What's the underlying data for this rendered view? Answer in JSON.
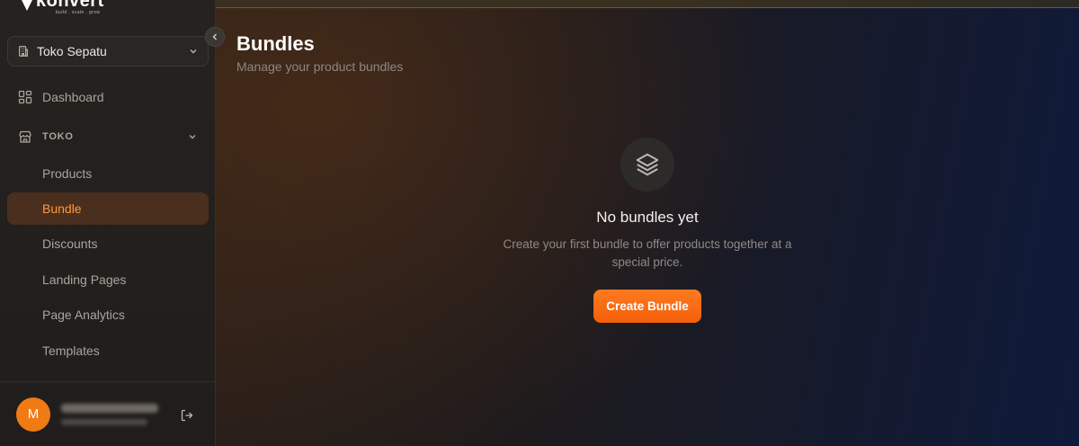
{
  "brand": {
    "name": "konvert",
    "tagline": "build . scale . grow"
  },
  "store_selector": {
    "value": "Toko Sepatu"
  },
  "sidebar": {
    "dashboard_label": "Dashboard",
    "section_label": "TOKO",
    "items": [
      {
        "label": "Products"
      },
      {
        "label": "Bundle",
        "active": true
      },
      {
        "label": "Discounts"
      },
      {
        "label": "Landing Pages"
      },
      {
        "label": "Page Analytics"
      },
      {
        "label": "Templates"
      }
    ]
  },
  "user": {
    "initial": "M"
  },
  "page": {
    "title": "Bundles",
    "subtitle": "Manage your product bundles"
  },
  "empty_state": {
    "icon": "layers-icon",
    "title": "No bundles yet",
    "description": "Create your first bundle to offer products together at a special price.",
    "button_label": "Create Bundle"
  },
  "colors": {
    "accent": "#f97316",
    "active_text": "#ff9a3c",
    "active_bg": "#4a2f1e"
  }
}
